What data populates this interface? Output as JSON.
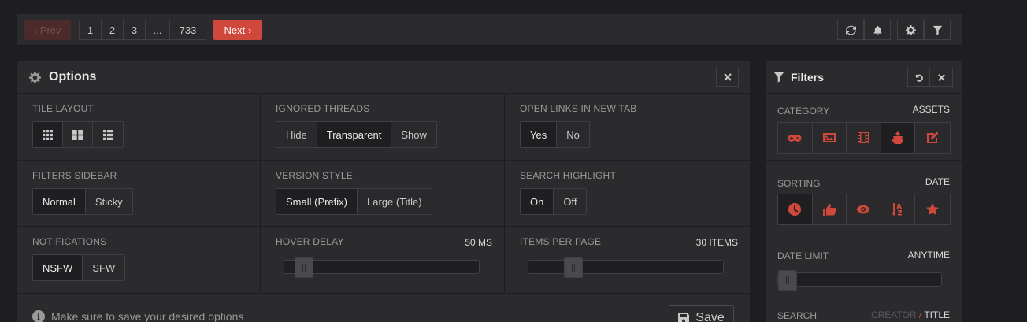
{
  "pagination": {
    "prev_label": "Prev",
    "pages": [
      "1",
      "2",
      "3",
      "...",
      "733"
    ],
    "next_label": "Next",
    "icons": [
      "refresh-icon",
      "bell-icon",
      "gear-icon",
      "filter-icon"
    ]
  },
  "options": {
    "title": "Options",
    "tile_layout": {
      "label": "TILE LAYOUT",
      "options": [
        "grid-small-icon",
        "grid-large-icon",
        "list-grid-icon"
      ]
    },
    "ignored_threads": {
      "label": "IGNORED THREADS",
      "options": [
        "Hide",
        "Transparent",
        "Show"
      ],
      "selected": "Transparent"
    },
    "open_links": {
      "label": "OPEN LINKS IN NEW TAB",
      "options": [
        "Yes",
        "No"
      ],
      "selected": "Yes"
    },
    "filters_sidebar": {
      "label": "FILTERS SIDEBAR",
      "options": [
        "Normal",
        "Sticky"
      ],
      "selected": "Normal"
    },
    "version_style": {
      "label": "VERSION STYLE",
      "options": [
        "Small (Prefix)",
        "Large (Title)"
      ],
      "selected": "Small (Prefix)"
    },
    "search_highlight": {
      "label": "SEARCH HIGHLIGHT",
      "options": [
        "On",
        "Off"
      ],
      "selected": "On"
    },
    "notifications": {
      "label": "NOTIFICATIONS",
      "options": [
        "NSFW",
        "SFW"
      ],
      "selected": "NSFW"
    },
    "hover_delay": {
      "label": "HOVER DELAY",
      "value": "50 MS",
      "fraction": 0.06
    },
    "items_per_page": {
      "label": "ITEMS PER PAGE",
      "value": "30 ITEMS",
      "fraction": 0.2
    },
    "notice": "Make sure to save your desired options",
    "save_label": "Save"
  },
  "filters": {
    "title": "Filters",
    "category": {
      "label": "CATEGORY",
      "value": "ASSETS",
      "icons": [
        "gamepad-icon",
        "image-icon",
        "film-icon",
        "assets-icon",
        "edit-icon"
      ],
      "selected_index": 3
    },
    "sorting": {
      "label": "SORTING",
      "value": "DATE",
      "icons": [
        "clock-icon",
        "thumbs-up-icon",
        "eye-icon",
        "sort-alpha-icon",
        "star-icon"
      ],
      "selected_index": 0
    },
    "date_limit": {
      "label": "DATE LIMIT",
      "value": "ANYTIME",
      "fraction": 0.0
    },
    "search": {
      "label": "SEARCH",
      "option_creator": "CREATOR",
      "separator": "/",
      "option_title": "TITLE"
    }
  },
  "colors": {
    "accent": "#d0473b",
    "panel": "#2b2b2e",
    "background": "#1e1e21"
  }
}
